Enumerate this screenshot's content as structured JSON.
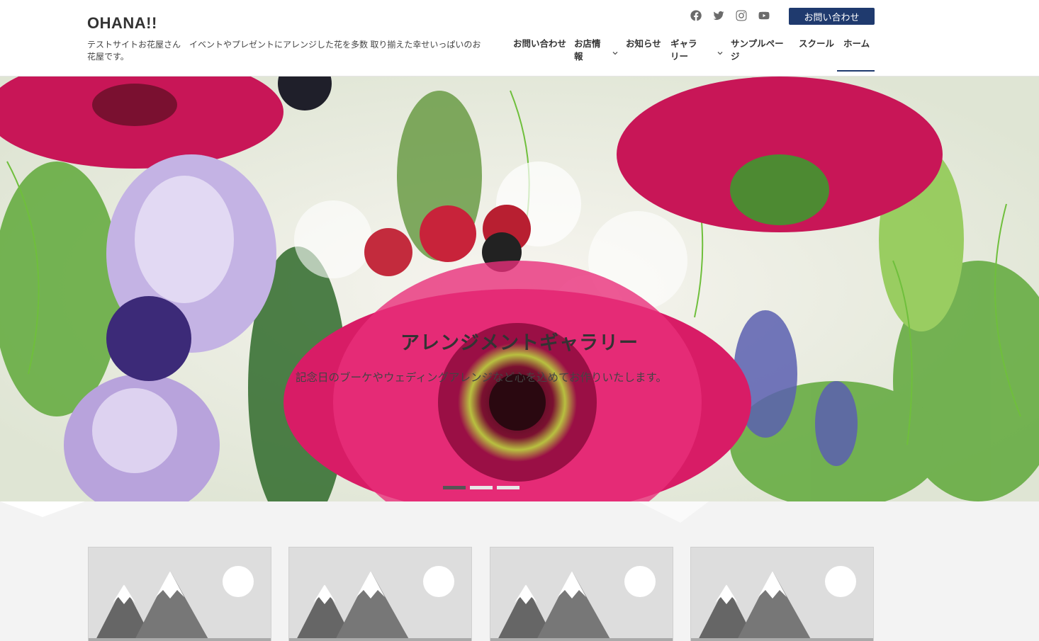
{
  "site": {
    "title": "OHANA!!",
    "tagline": "テストサイトお花屋さん　イベントやプレゼントにアレンジした花を多数 取り揃えた幸せいっぱいのお花屋です。"
  },
  "header": {
    "social_icons": [
      "facebook-icon",
      "twitter-icon",
      "instagram-icon",
      "youtube-icon"
    ],
    "contact_button": "お問い合わせ"
  },
  "nav": {
    "items": [
      {
        "label": "お問い合わせ",
        "dropdown": false
      },
      {
        "label": "お店情報",
        "dropdown": true
      },
      {
        "label": "お知らせ",
        "dropdown": false
      },
      {
        "label": "ギャラリー",
        "dropdown": true
      },
      {
        "label": "サンプルページ",
        "dropdown": false
      },
      {
        "label": "スクール",
        "dropdown": false
      },
      {
        "label": "ホーム",
        "dropdown": false,
        "active": true
      }
    ]
  },
  "hero": {
    "title": "アレンジメントギャラリー",
    "subtitle": "記念日のブーケやウェディングアレンジなど心を込めてお作りいたします。",
    "slides": 3,
    "active_slide": 1
  },
  "cards": [
    "placeholder-image",
    "placeholder-image",
    "placeholder-image",
    "placeholder-image"
  ],
  "colors": {
    "accent": "#1f3a6e",
    "pink": "#d0135c",
    "lavender": "#b9a7dc",
    "leaf": "#3c7a2e"
  }
}
